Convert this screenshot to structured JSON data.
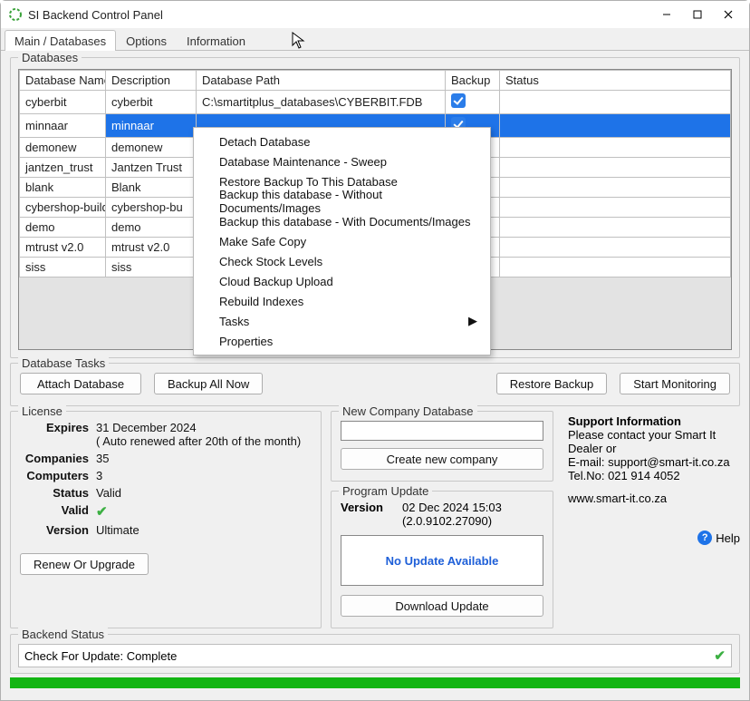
{
  "window": {
    "title": "SI Backend Control Panel"
  },
  "tabs": {
    "main": "Main / Databases",
    "options": "Options",
    "info": "Information"
  },
  "databases": {
    "group_label": "Databases",
    "headers": {
      "name": "Database Name",
      "desc": "Description",
      "path": "Database Path",
      "backup": "Backup",
      "status": "Status"
    },
    "rows": [
      {
        "name": "cyberbit",
        "desc": "cyberbit",
        "path": "C:\\smartitplus_databases\\CYBERBIT.FDB",
        "backup": true
      },
      {
        "name": "minnaar",
        "desc": "minnaar",
        "path": "",
        "backup": true,
        "selected": true
      },
      {
        "name": "demonew",
        "desc": "demonew",
        "path": "",
        "backup": false
      },
      {
        "name": "jantzen_trust",
        "desc": "Jantzen Trust",
        "path": "",
        "backup": false
      },
      {
        "name": "blank",
        "desc": "Blank",
        "path": "",
        "backup": false
      },
      {
        "name": "cybershop-builders",
        "desc": "cybershop-bu",
        "path": "",
        "backup": false
      },
      {
        "name": "demo",
        "desc": "demo",
        "path": "",
        "backup": false
      },
      {
        "name": "mtrust v2.0",
        "desc": "mtrust v2.0",
        "path": "",
        "backup": false
      },
      {
        "name": "siss",
        "desc": "siss",
        "path": "",
        "backup": false
      }
    ]
  },
  "context_menu": {
    "items": [
      "Detach Database",
      "Database Maintenance - Sweep",
      "Restore Backup To This Database",
      "Backup this database - Without Documents/Images",
      "Backup this database - With Documents/Images",
      "Make Safe Copy",
      "Check Stock Levels",
      "Cloud Backup Upload",
      "Rebuild Indexes",
      "Tasks",
      "Properties"
    ],
    "submenu_index": 9
  },
  "tasks": {
    "group_label": "Database Tasks",
    "attach": "Attach Database",
    "backup_all": "Backup All Now",
    "restore": "Restore Backup",
    "start_mon": "Start Monitoring"
  },
  "license": {
    "group_label": "License",
    "expires_k": "Expires",
    "expires_v": "31 December 2024",
    "expires_note": "( Auto renewed after 20th of the month)",
    "companies_k": "Companies",
    "companies_v": "35",
    "computers_k": "Computers",
    "computers_v": "3",
    "status_k": "Status",
    "status_v": "Valid",
    "valid_k": "Valid",
    "version_k": "Version",
    "version_v": "Ultimate",
    "renew": "Renew Or Upgrade"
  },
  "newdb": {
    "group_label": "New Company Database",
    "create": "Create new company"
  },
  "update": {
    "group_label": "Program Update",
    "version_k": "Version",
    "version_v": "02 Dec 2024 15:03 (2.0.9102.27090)",
    "no_update": "No Update Available",
    "download": "Download Update"
  },
  "support": {
    "heading": "Support Information",
    "line1": "Please contact your Smart It Dealer or",
    "email_label": "E-mail: ",
    "email": "support@smart-it.co.za",
    "tel_label": "Tel.No:  ",
    "tel": "021 914 4052",
    "web": "www.smart-it.co.za",
    "help": "Help"
  },
  "status": {
    "group_label": "Backend Status",
    "text": "Check For Update: Complete"
  }
}
